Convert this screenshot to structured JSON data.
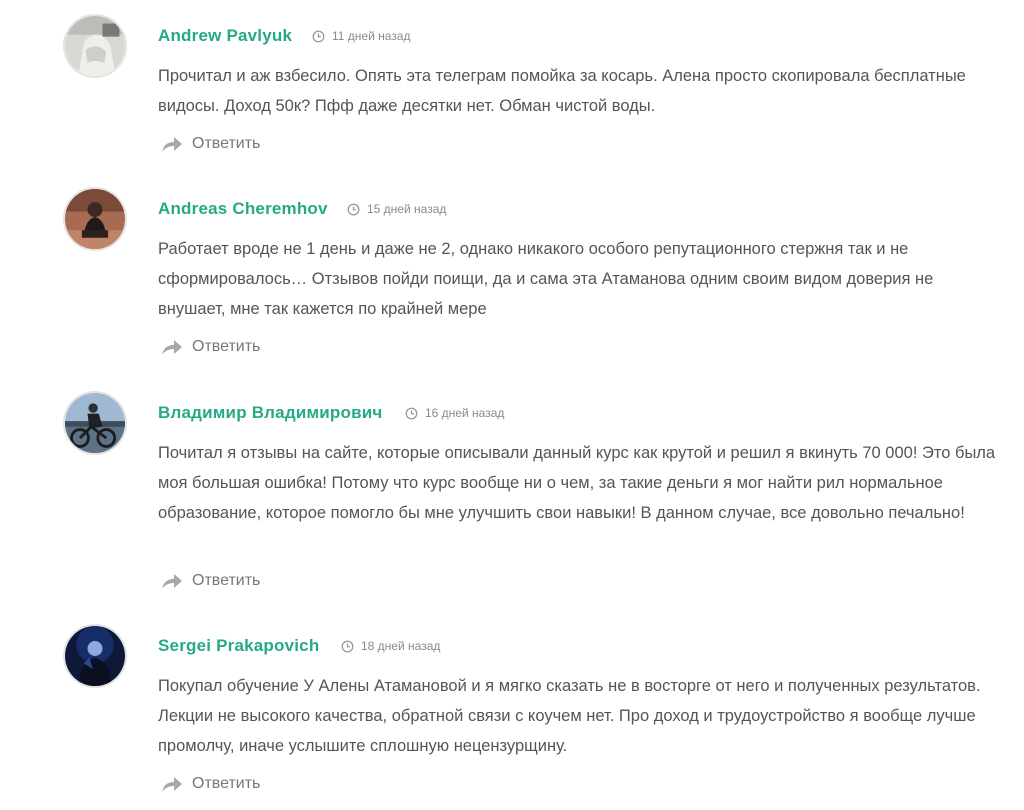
{
  "comments": [
    {
      "author": "Andrew Pavlyuk",
      "time": "11 дней назад",
      "text": "Прочитал и аж взбесило. Опять эта телеграм помойка за косарь. Алена просто скопировала бесплатные видосы. Доход 50к? Пфф даже десятки нет. Обман чистой воды.",
      "reply_label": "Ответить"
    },
    {
      "author": "Andreas Cheremhov",
      "time": "15 дней назад",
      "text": "Работает вроде не 1 день и даже не 2, однако никакого особого репутационного стержня так и не сформировалось… Отзывов пойди поищи, да и сама эта Атаманова одним своим видом доверия не внушает, мне так кажется по крайней мере",
      "reply_label": "Ответить"
    },
    {
      "author": "Владимир Владимирович",
      "time": "16 дней назад",
      "text": "Почитал я отзывы на сайте, которые описывали данный курс как крутой и решил я вкинуть 70 000! Это была моя большая ошибка! Потому что курс вообще ни о чем, за такие деньги я мог найти рил нормальное образование, которое помогло бы мне улучшить свои навыки! В данном случае, все довольно печально!",
      "reply_label": "Ответить"
    },
    {
      "author": "Sergei Prakapovich",
      "time": "18 дней назад",
      "text": "Покупал обучение У Алены Атамановой и я мягко сказать не в восторге от него и полученных результатов. Лекции не высокого качества, обратной связи с коучем нет. Про доход и трудоустройство я вообще лучше промолчу, иначе услышите сплошную нецензурщину.",
      "reply_label": "Ответить"
    }
  ],
  "colors": {
    "author": "#26a987",
    "text": "#555555",
    "meta": "#8a8a8a"
  },
  "icons": {
    "time": "clock-icon",
    "reply": "reply-arrow-icon"
  }
}
